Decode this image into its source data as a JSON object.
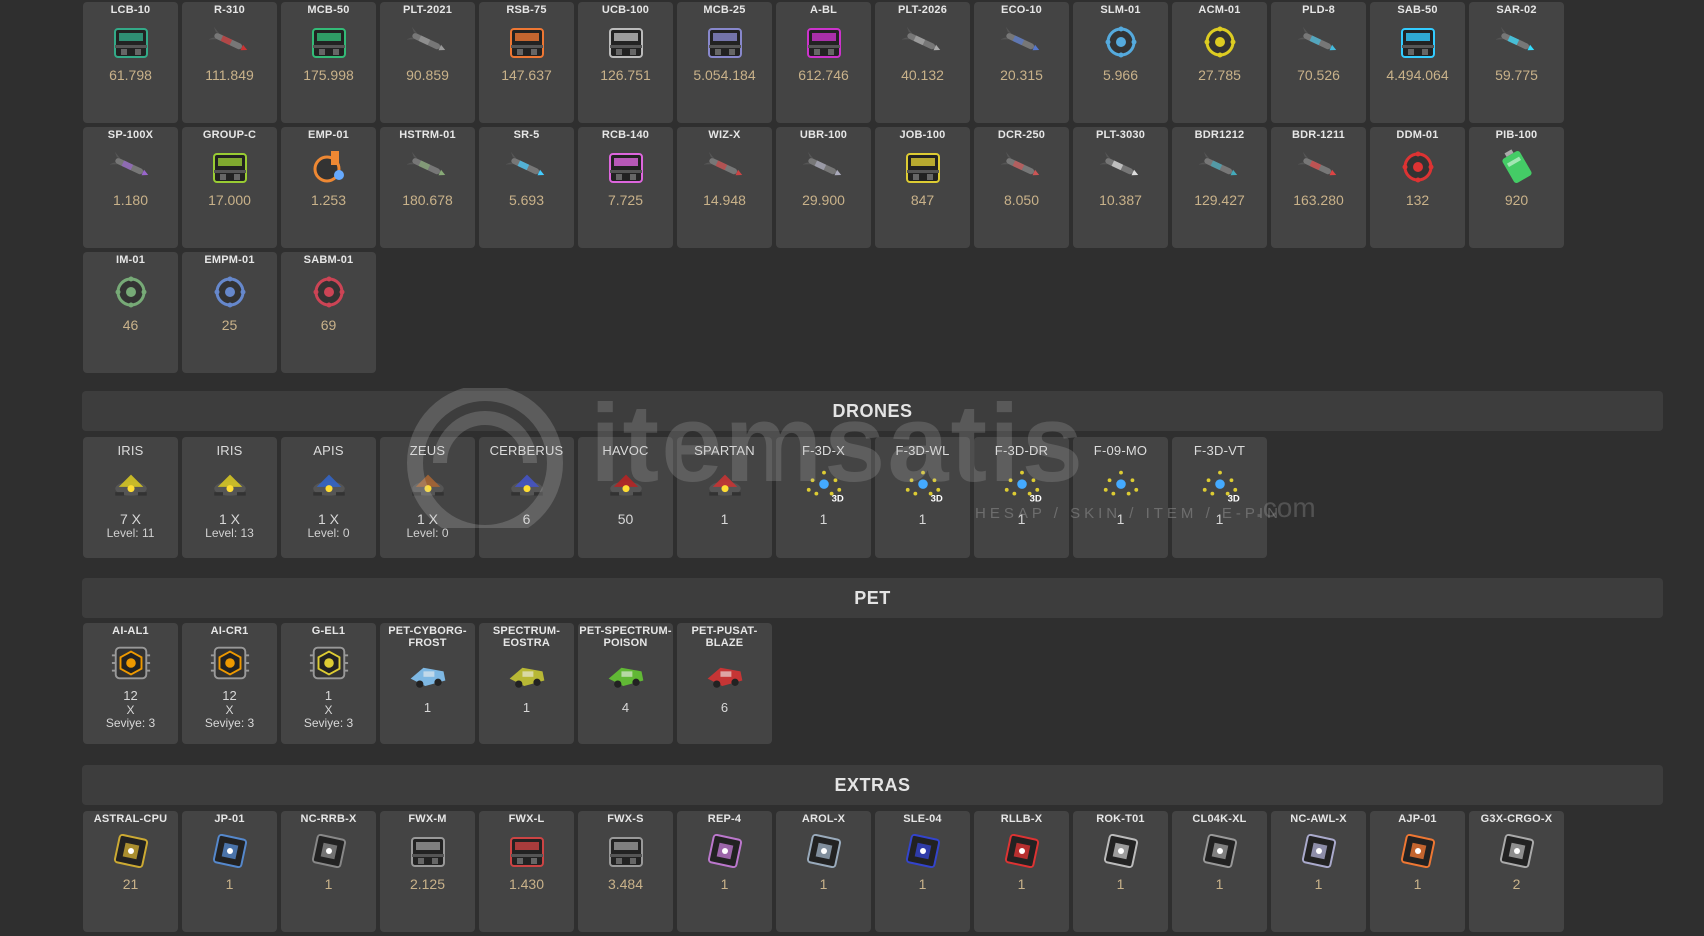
{
  "ammo": [
    {
      "name": "LCB-10",
      "value": "61.798",
      "icon": "ammo-crate-green",
      "color": "#3a8"
    },
    {
      "name": "R-310",
      "value": "111.849",
      "icon": "rocket-red",
      "color": "#c33"
    },
    {
      "name": "MCB-50",
      "value": "175.998",
      "icon": "ammo-crate-green",
      "color": "#3b7"
    },
    {
      "name": "PLT-2021",
      "value": "90.859",
      "icon": "rocket-grey",
      "color": "#999"
    },
    {
      "name": "RSB-75",
      "value": "147.637",
      "icon": "ammo-crate-orange",
      "color": "#e73"
    },
    {
      "name": "UCB-100",
      "value": "126.751",
      "icon": "ammo-crate-grey",
      "color": "#bbb"
    },
    {
      "name": "MCB-25",
      "value": "5.054.184",
      "icon": "ammo-crate-blue",
      "color": "#88c"
    },
    {
      "name": "A-BL",
      "value": "612.746",
      "icon": "ammo-crate-pink",
      "color": "#c3c"
    },
    {
      "name": "PLT-2026",
      "value": "40.132",
      "icon": "rocket-grey",
      "color": "#aaa"
    },
    {
      "name": "ECO-10",
      "value": "20.315",
      "icon": "rocket-blue",
      "color": "#57c"
    },
    {
      "name": "SLM-01",
      "value": "5.966",
      "icon": "mine-blue",
      "color": "#5ad"
    },
    {
      "name": "ACM-01",
      "value": "27.785",
      "icon": "mine-yellow",
      "color": "#dc2"
    },
    {
      "name": "PLD-8",
      "value": "70.526",
      "icon": "rocket-cyan",
      "color": "#4bd"
    },
    {
      "name": "SAB-50",
      "value": "4.494.064",
      "icon": "ammo-crate-cyan",
      "color": "#3cf"
    },
    {
      "name": "SAR-02",
      "value": "59.775",
      "icon": "rocket-cyan",
      "color": "#3df"
    },
    {
      "name": "SP-100X",
      "value": "1.180",
      "icon": "rocket-purple",
      "color": "#96c"
    },
    {
      "name": "GROUP-C",
      "value": "17.000",
      "icon": "crate-green",
      "color": "#9c3"
    },
    {
      "name": "EMP-01",
      "value": "1.253",
      "icon": "emp-orange",
      "color": "#e83"
    },
    {
      "name": "HSTRM-01",
      "value": "180.678",
      "icon": "rocket-green",
      "color": "#8a7"
    },
    {
      "name": "SR-5",
      "value": "5.693",
      "icon": "rocket-cyan",
      "color": "#4cf"
    },
    {
      "name": "RCB-140",
      "value": "7.725",
      "icon": "ammo-crate-pink",
      "color": "#d6d"
    },
    {
      "name": "WIZ-X",
      "value": "14.948",
      "icon": "rocket-red",
      "color": "#c44"
    },
    {
      "name": "UBR-100",
      "value": "29.900",
      "icon": "rocket-grey",
      "color": "#aab"
    },
    {
      "name": "JOB-100",
      "value": "847",
      "icon": "ammo-crate-yellow",
      "color": "#dc3"
    },
    {
      "name": "DCR-250",
      "value": "8.050",
      "icon": "rocket-red",
      "color": "#c55"
    },
    {
      "name": "PLT-3030",
      "value": "10.387",
      "icon": "rocket-white",
      "color": "#ddd"
    },
    {
      "name": "BDR1212",
      "value": "129.427",
      "icon": "rocket-teal",
      "color": "#4ab"
    },
    {
      "name": "BDR-1211",
      "value": "163.280",
      "icon": "rocket-red",
      "color": "#d44"
    },
    {
      "name": "DDM-01",
      "value": "132",
      "icon": "mine-red",
      "color": "#d33"
    },
    {
      "name": "PIB-100",
      "value": "920",
      "icon": "battery-green",
      "color": "#4c6"
    },
    {
      "name": "IM-01",
      "value": "46",
      "icon": "mine-spiky",
      "color": "#7a7"
    },
    {
      "name": "EMPM-01",
      "value": "25",
      "icon": "mine-blue",
      "color": "#68c"
    },
    {
      "name": "SABM-01",
      "value": "69",
      "icon": "mine-red",
      "color": "#c45"
    }
  ],
  "drones_title": "DRONES",
  "drones": [
    {
      "name": "IRIS",
      "value": "7 X",
      "level": "Level: 11",
      "icon": "drone-iris",
      "color": "#dc2"
    },
    {
      "name": "IRIS",
      "value": "1 X",
      "level": "Level: 13",
      "icon": "drone-iris",
      "color": "#dc2"
    },
    {
      "name": "APIS",
      "value": "1 X",
      "level": "Level: 0",
      "icon": "drone-apis",
      "color": "#36c"
    },
    {
      "name": "ZEUS",
      "value": "1 X",
      "level": "Level: 0",
      "icon": "drone-zeus",
      "color": "#a63"
    },
    {
      "name": "CERBERUS",
      "value": "6",
      "level": "",
      "icon": "drone-cerberus",
      "color": "#45c"
    },
    {
      "name": "HAVOC",
      "value": "50",
      "level": "",
      "icon": "drone-havoc",
      "color": "#b22"
    },
    {
      "name": "SPARTAN",
      "value": "1",
      "level": "",
      "icon": "drone-spartan",
      "color": "#c33"
    },
    {
      "name": "F-3D-X",
      "value": "1",
      "level": "",
      "icon": "drone-formation-3d",
      "color": "#dc3"
    },
    {
      "name": "F-3D-WL",
      "value": "1",
      "level": "",
      "icon": "drone-formation-3d",
      "color": "#dc3"
    },
    {
      "name": "F-3D-DR",
      "value": "1",
      "level": "",
      "icon": "drone-formation-3d",
      "color": "#dc3"
    },
    {
      "name": "F-09-MO",
      "value": "1",
      "level": "",
      "icon": "drone-formation",
      "color": "#dc3"
    },
    {
      "name": "F-3D-VT",
      "value": "1",
      "level": "",
      "icon": "drone-formation-3d",
      "color": "#dc3"
    }
  ],
  "pet_title": "PET",
  "pets": [
    {
      "name": "AI-AL1",
      "lines": [
        "12",
        "X",
        "Seviye: 3"
      ],
      "icon": "chip-orange",
      "color": "#e90"
    },
    {
      "name": "AI-CR1",
      "lines": [
        "12",
        "X",
        "Seviye: 3"
      ],
      "icon": "chip-orange",
      "color": "#e90"
    },
    {
      "name": "G-EL1",
      "lines": [
        "1",
        "X",
        "Seviye: 3"
      ],
      "icon": "chip-yellow",
      "color": "#dc3"
    },
    {
      "name": "PET-CYBORG-FROST",
      "lines": [
        "1"
      ],
      "icon": "pet-frost",
      "color": "#8cf"
    },
    {
      "name": "SPECTRUM-EOSTRA",
      "lines": [
        "1"
      ],
      "icon": "pet-spectrum",
      "color": "#cc3"
    },
    {
      "name": "PET-SPECTRUM-POISON",
      "lines": [
        "4"
      ],
      "icon": "pet-poison",
      "color": "#6c3"
    },
    {
      "name": "PET-PUSAT-BLAZE",
      "lines": [
        "6"
      ],
      "icon": "pet-blaze",
      "color": "#d33"
    }
  ],
  "extras_title": "EXTRAS",
  "extras": [
    {
      "name": "ASTRAL-CPU",
      "value": "21",
      "icon": "cpu-astral",
      "color": "#ca3"
    },
    {
      "name": "JP-01",
      "value": "1",
      "icon": "jump-cpu",
      "color": "#58c"
    },
    {
      "name": "NC-RRB-X",
      "value": "1",
      "icon": "cpu-black",
      "color": "#888"
    },
    {
      "name": "FWX-M",
      "value": "2.125",
      "icon": "firework-crate",
      "color": "#999"
    },
    {
      "name": "FWX-L",
      "value": "1.430",
      "icon": "firework-crate-red",
      "color": "#c44"
    },
    {
      "name": "FWX-S",
      "value": "3.484",
      "icon": "firework-crate",
      "color": "#999"
    },
    {
      "name": "REP-4",
      "value": "1",
      "icon": "repair-bot",
      "color": "#b7c"
    },
    {
      "name": "AROL-X",
      "value": "1",
      "icon": "cpu-arol",
      "color": "#9ab"
    },
    {
      "name": "SLE-04",
      "value": "1",
      "icon": "cpu-blue",
      "color": "#34c"
    },
    {
      "name": "RLLB-X",
      "value": "1",
      "icon": "cpu-rllb",
      "color": "#d33"
    },
    {
      "name": "ROK-T01",
      "value": "1",
      "icon": "cpu-rok",
      "color": "#bbb"
    },
    {
      "name": "CL04K-XL",
      "value": "1",
      "icon": "cloak-cpu",
      "color": "#999"
    },
    {
      "name": "NC-AWL-X",
      "value": "1",
      "icon": "cpu-awl",
      "color": "#aac"
    },
    {
      "name": "AJP-01",
      "value": "1",
      "icon": "jump-cpu-advanced",
      "color": "#e73"
    },
    {
      "name": "G3X-CRGO-X",
      "value": "2",
      "icon": "cargo-cpu",
      "color": "#aaa"
    }
  ],
  "watermark": {
    "brand": "itemsatis",
    "tagline": "HESAP / SKIN / ITEM / E-PIN",
    "domain": ".com"
  }
}
